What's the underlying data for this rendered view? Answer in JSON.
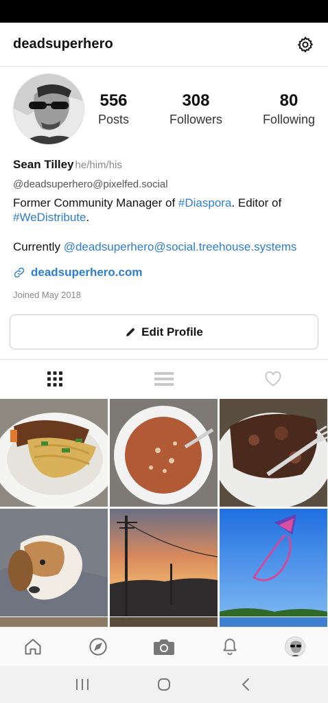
{
  "header": {
    "username": "deadsuperhero",
    "settings_icon": "gear-icon"
  },
  "profile": {
    "stats": [
      {
        "count": "556",
        "label": "Posts"
      },
      {
        "count": "308",
        "label": "Followers"
      },
      {
        "count": "80",
        "label": "Following"
      }
    ],
    "display_name": "Sean Tilley",
    "pronouns": "he/him/his",
    "handle": "@deadsuperhero@pixelfed.social",
    "bio": {
      "part1": "Former Community Manager of ",
      "tag1": "#Diaspora",
      "part2": ". Editor of ",
      "tag2": "#WeDistribute",
      "part3": ".",
      "current_prefix": "Currently ",
      "current_link": "@deadsuperhero@social.treehouse.systems"
    },
    "website": "deadsuperhero.com",
    "joined": "Joined May 2018"
  },
  "actions": {
    "edit_profile": "Edit Profile"
  },
  "view_tabs": [
    {
      "icon": "grid-icon",
      "active": true
    },
    {
      "icon": "list-icon",
      "active": false
    },
    {
      "icon": "heart-icon",
      "active": false
    }
  ],
  "colors": {
    "link": "#2d7ecf",
    "text": "#111111",
    "muted": "#888888"
  },
  "bottom_nav": [
    "home-icon",
    "compass-icon",
    "camera-icon",
    "bell-icon",
    "profile-avatar"
  ],
  "system_nav": [
    "recents-icon",
    "home-circle-icon",
    "back-icon"
  ]
}
